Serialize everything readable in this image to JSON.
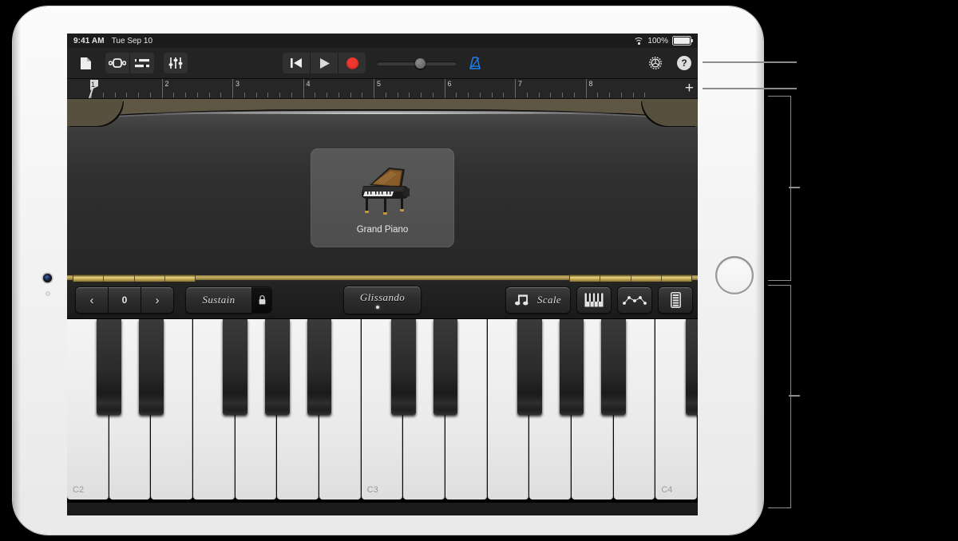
{
  "status_bar": {
    "time": "9:41 AM",
    "date": "Tue Sep 10",
    "battery_percent": "100%",
    "wifi_icon": "wifi-icon",
    "battery_icon": "battery-icon"
  },
  "toolbar": {
    "my_songs_icon": "document-icon",
    "browser_icon": "instrument-browser-icon",
    "tracks_icon": "track-view-icon",
    "mixer_icon": "mixer-sliders-icon",
    "rewind_icon": "rewind-to-start-icon",
    "play_icon": "play-icon",
    "record_icon": "record-icon",
    "master_volume_label": "Master Volume",
    "metronome_icon": "metronome-icon",
    "settings_icon": "gear-icon",
    "help_label": "?"
  },
  "ruler": {
    "bars": [
      "1",
      "2",
      "3",
      "4",
      "5",
      "6",
      "7",
      "8"
    ],
    "playhead_bar": "1",
    "add_track_label": "+"
  },
  "instrument": {
    "name": "Grand Piano",
    "icon": "grand-piano-icon"
  },
  "controls": {
    "octave_down_label": "‹",
    "octave_value": "0",
    "octave_up_label": "›",
    "sustain_label": "Sustain",
    "sustain_lock_icon": "lock-icon",
    "glissando_label": "Glissando",
    "glissando_mode_dots": [
      "on",
      "off"
    ],
    "scale_label": "Scale",
    "scale_notes_icon": "beamed-notes-icon",
    "keyboard_layout_icon": "keyboard-icon",
    "arpeggiator_icon": "arpeggiator-icon",
    "key_size_icon": "keyboard-strip-icon"
  },
  "keyboard": {
    "white_keys": [
      {
        "label": "C2"
      },
      {
        "label": ""
      },
      {
        "label": ""
      },
      {
        "label": ""
      },
      {
        "label": ""
      },
      {
        "label": ""
      },
      {
        "label": ""
      },
      {
        "label": "C3"
      },
      {
        "label": ""
      },
      {
        "label": ""
      },
      {
        "label": ""
      },
      {
        "label": ""
      },
      {
        "label": ""
      },
      {
        "label": ""
      },
      {
        "label": "C4"
      }
    ],
    "black_key_positions": [
      0,
      1,
      3,
      4,
      5,
      7,
      8,
      10,
      11,
      12,
      14
    ],
    "octave_labels": [
      "C2",
      "C3",
      "C4"
    ]
  },
  "colors": {
    "record_red": "#f0372e",
    "metronome_blue": "#1f7ff0",
    "stage_olive": "#57503e",
    "trim_gold": "#cbb268",
    "callout_gray": "#8c8c8c"
  }
}
